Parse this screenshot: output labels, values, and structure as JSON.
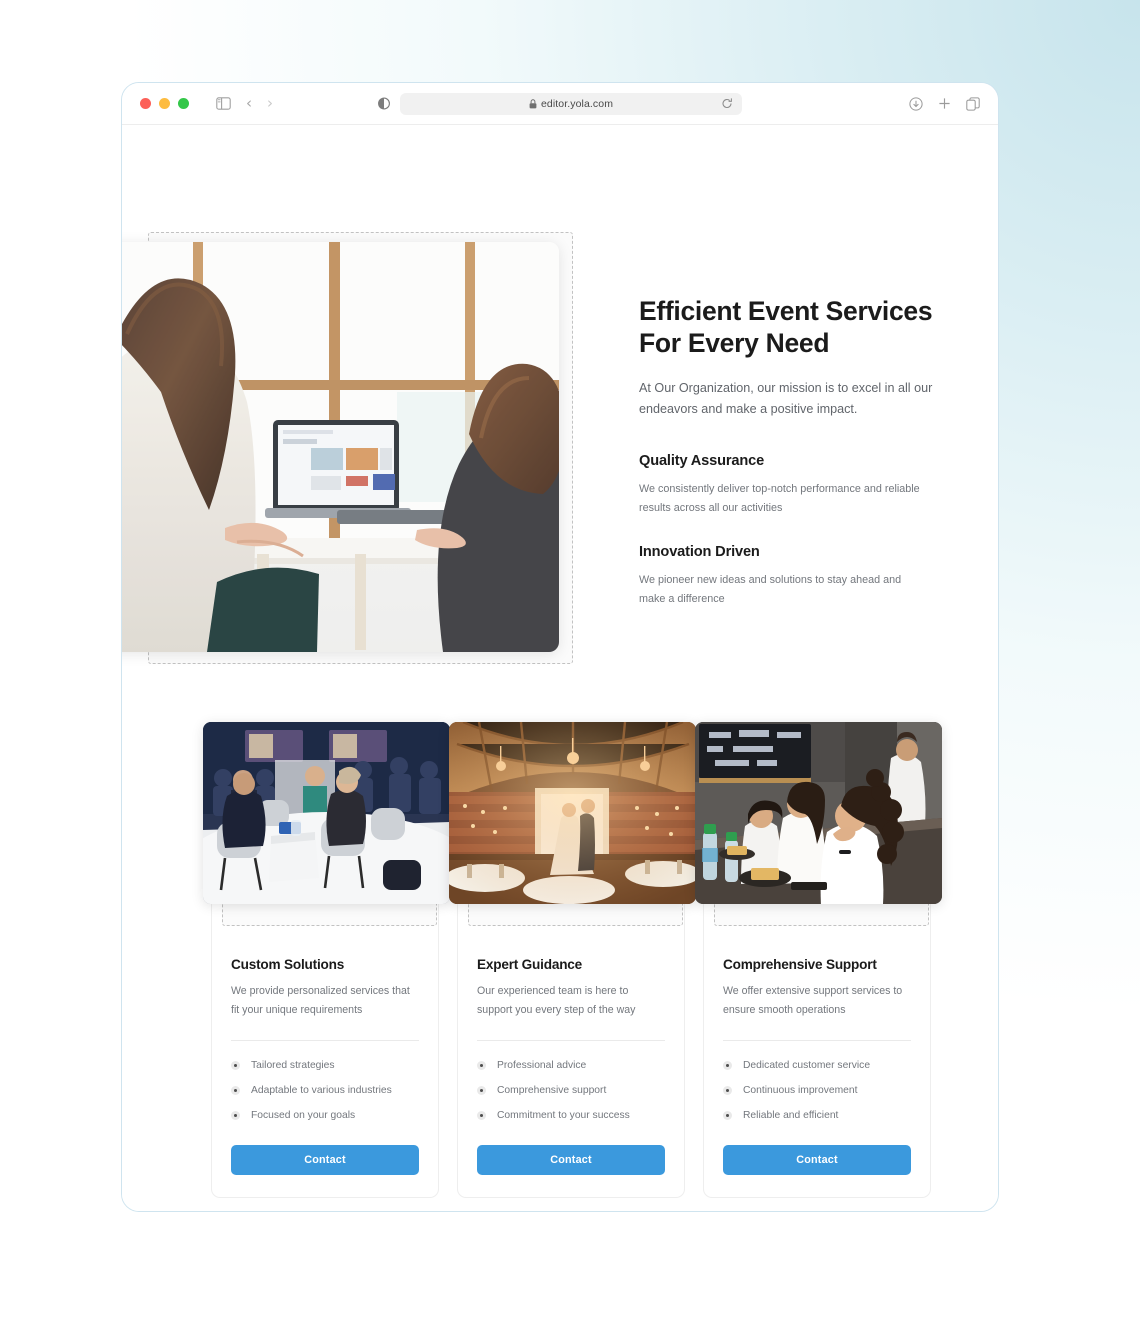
{
  "browser": {
    "url": "editor.yola.com",
    "traffic_lights": [
      "close",
      "minimize",
      "maximize"
    ],
    "left_icons": [
      "sidebar-toggle-icon",
      "back-chevron-icon",
      "forward-chevron-icon"
    ],
    "center_icons": [
      "reader-mode-icon",
      "lock-icon",
      "reload-icon"
    ],
    "right_icons": [
      "download-icon",
      "new-tab-icon",
      "tab-overview-icon"
    ]
  },
  "hero": {
    "title_line1": "Efficient Event Services",
    "title_line2": "For Every Need",
    "subtitle": "At Our Organization, our mission is to excel in all our endeavors and make a positive impact.",
    "image_alt": "two-women-at-laptop-photo",
    "features": [
      {
        "title": "Quality Assurance",
        "body": "We consistently deliver top-notch performance and reliable results across all our activities"
      },
      {
        "title": "Innovation Driven",
        "body": "We pioneer new ideas and solutions to stay ahead and make a difference"
      }
    ]
  },
  "cards": [
    {
      "image_alt": "conference-panel-photo",
      "title": "Custom Solutions",
      "description": "We provide personalized services that fit your unique requirements",
      "bullets": [
        "Tailored strategies",
        "Adaptable to various industries",
        "Focused on your goals"
      ],
      "button_label": "Contact"
    },
    {
      "image_alt": "barn-wedding-venue-photo",
      "title": "Expert Guidance",
      "description": "Our experienced team is here to support you every step of the way",
      "bullets": [
        "Professional advice",
        "Comprehensive support",
        "Commitment to your success"
      ],
      "button_label": "Contact"
    },
    {
      "image_alt": "team-meeting-lunch-photo",
      "title": "Comprehensive Support",
      "description": "We offer extensive support services to ensure smooth operations",
      "bullets": [
        "Dedicated customer service",
        "Continuous improvement",
        "Reliable and efficient"
      ],
      "button_label": "Contact"
    }
  ],
  "colors": {
    "accent_blue": "#3b99dd",
    "heading": "#1b1b1b",
    "body_text": "#73777d",
    "window_border": "#cfe4ef",
    "page_bg_tint": "#c7e4ec"
  }
}
